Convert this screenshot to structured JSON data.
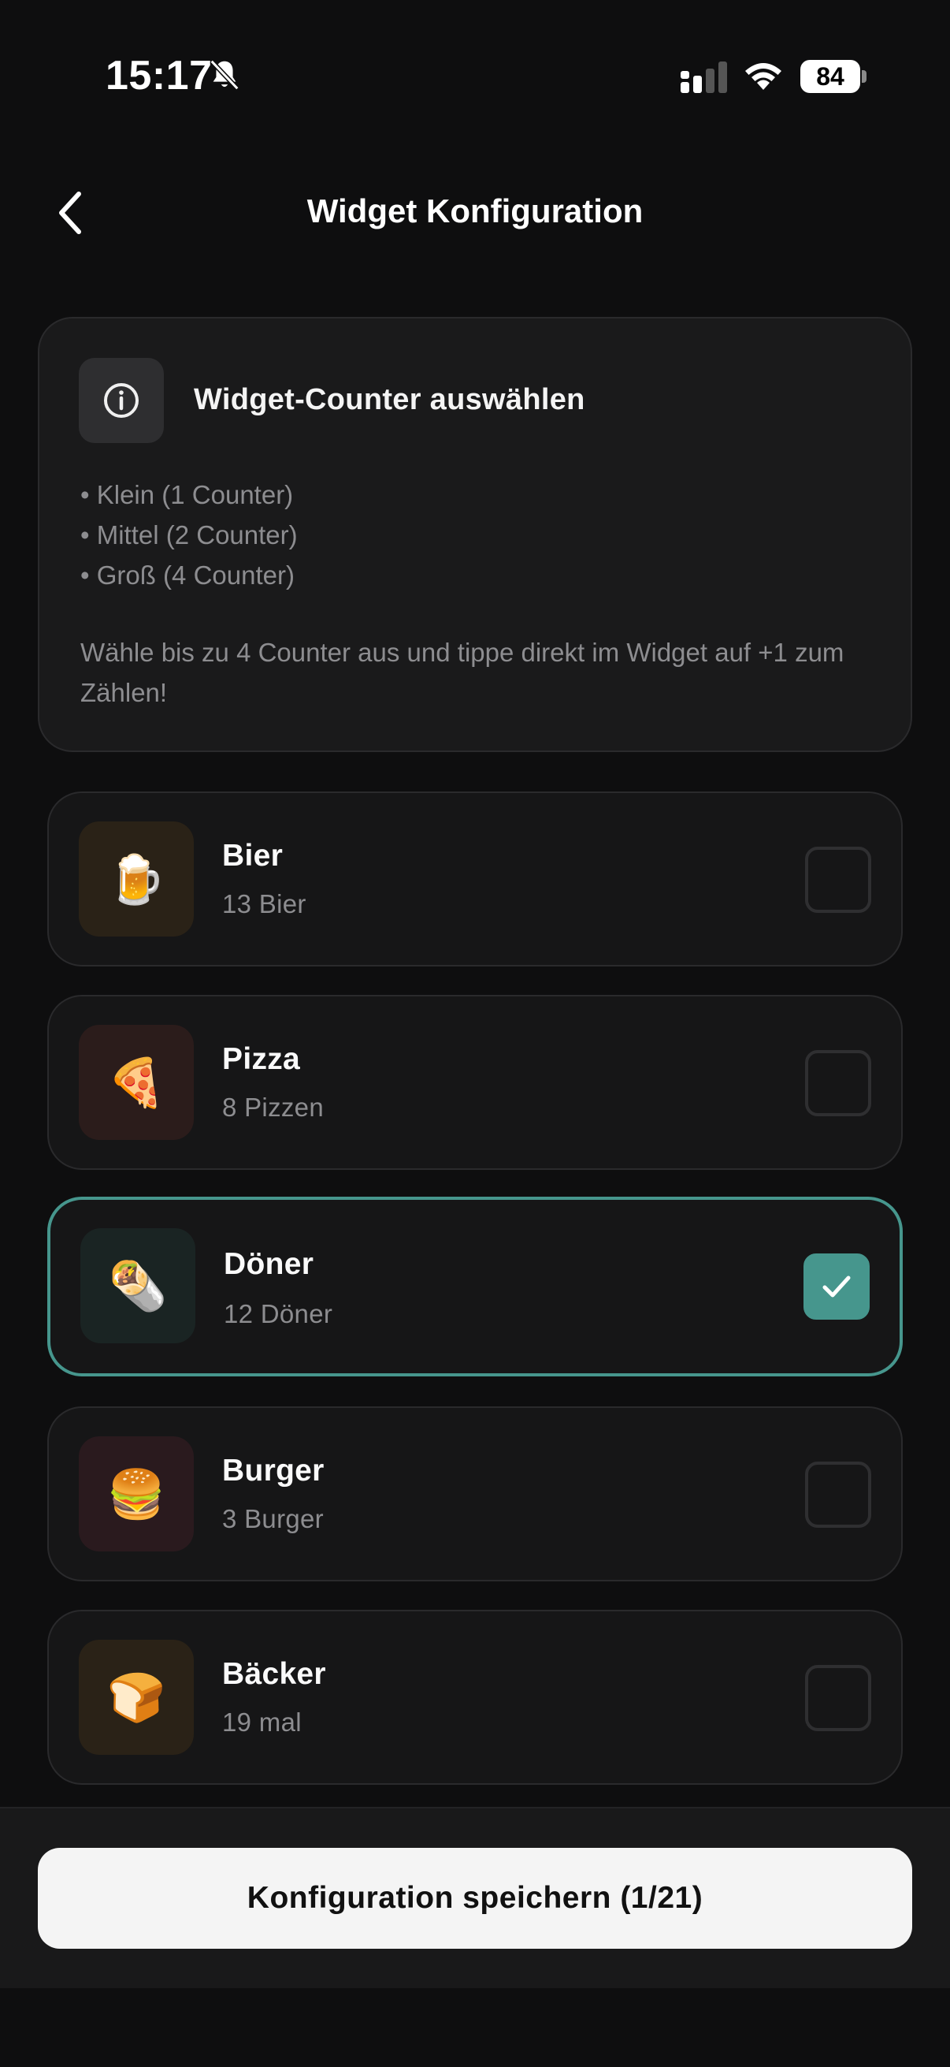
{
  "status_bar": {
    "time": "15:17",
    "battery": "84",
    "icons": [
      "bell-slash-icon",
      "cellular-signal-icon",
      "wifi-icon",
      "battery-icon"
    ]
  },
  "nav": {
    "back_icon": "chevron-left-icon",
    "title": "Widget Konfiguration"
  },
  "info": {
    "icon": "info-circle-icon",
    "title": "Widget-Counter auswählen",
    "sizes": [
      "• Klein (1 Counter)",
      "• Mittel (2 Counter)",
      "• Groß (4 Counter)"
    ],
    "description": "Wähle bis zu 4 Counter aus und tippe direkt im Widget auf +1 zum Zählen!"
  },
  "counters": [
    {
      "emoji": "🍺",
      "name": "Bier",
      "count": "13 Bier",
      "selected": false,
      "tint": "#2a2217"
    },
    {
      "emoji": "🍕",
      "name": "Pizza",
      "count": "8 Pizzen",
      "selected": false,
      "tint": "#2b1c1b"
    },
    {
      "emoji": "🌯",
      "name": "Döner",
      "count": "12 Döner",
      "selected": true,
      "tint": "#1a2423"
    },
    {
      "emoji": "🍔",
      "name": "Burger",
      "count": "3 Burger",
      "selected": false,
      "tint": "#2a1a1e"
    },
    {
      "emoji": "🍞",
      "name": "Bäcker",
      "count": "19 mal",
      "selected": false,
      "tint": "#2a2217"
    }
  ],
  "footer": {
    "save_label": "Konfiguration speichern (1/21)"
  },
  "colors": {
    "accent": "#46968d",
    "background": "#0e0e0f",
    "card": "#1a1a1b"
  }
}
